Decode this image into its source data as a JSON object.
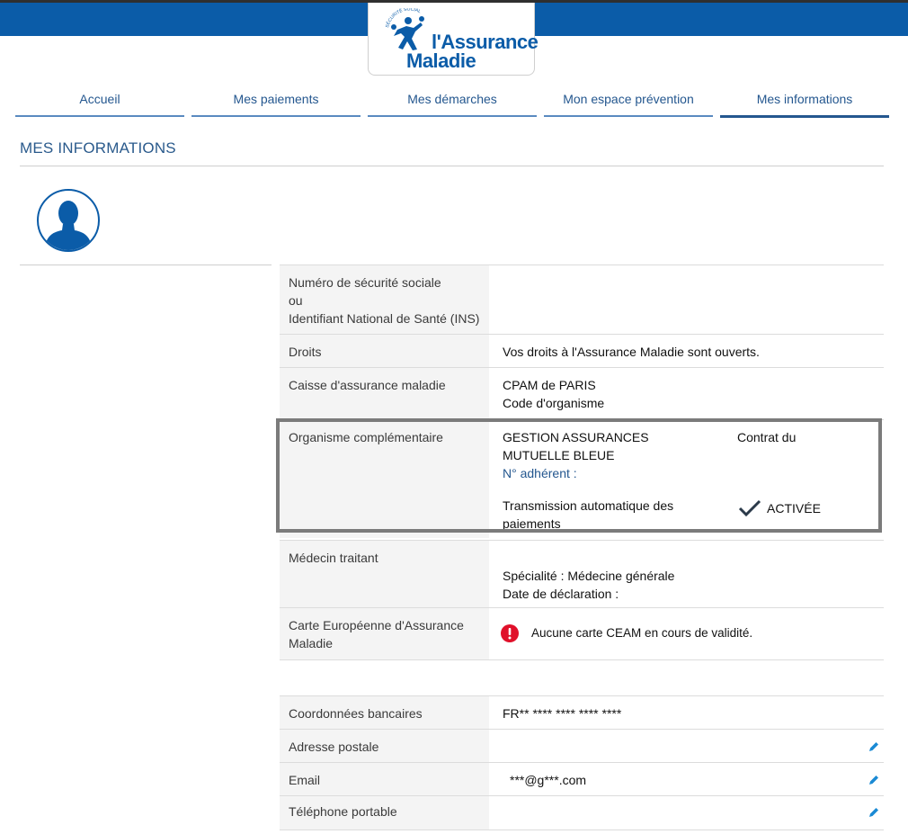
{
  "brand": {
    "logo_line1": "l'Assurance",
    "logo_line2": "Maladie",
    "logo_arc": "SÉCURITÉ SOCIALE",
    "color": "#0b5ca8"
  },
  "nav": {
    "items": [
      {
        "label": "Accueil"
      },
      {
        "label": "Mes paiements"
      },
      {
        "label": "Mes démarches"
      },
      {
        "label": "Mon espace prévention"
      },
      {
        "label": "Mes informations"
      }
    ],
    "active": "Mes informations"
  },
  "page": {
    "title": "MES INFORMATIONS"
  },
  "rows": {
    "nss": {
      "label": "Numéro de sécurité sociale\nou\nIdentifiant National de Santé (INS)"
    },
    "droits": {
      "label": "Droits",
      "value": "Vos droits à l'Assurance Maladie sont ouverts."
    },
    "caisse": {
      "label": "Caisse d'assurance maladie",
      "value1": "CPAM de PARIS",
      "value2": "Code d'organisme"
    },
    "complementaire": {
      "label": "Organisme complémentaire",
      "org1": "GESTION ASSURANCES",
      "org2": "MUTUELLE BLEUE",
      "adherent": "N° adhérent :",
      "contrat": "Contrat du",
      "transmission": "Transmission automatique des paiements",
      "status": "ACTIVÉE"
    },
    "medecin": {
      "label": "Médecin traitant",
      "specialite": "Spécialité : Médecine générale",
      "date": "Date de déclaration :"
    },
    "ceam": {
      "label": "Carte Européenne d'Assurance Maladie",
      "value": "Aucune carte CEAM en cours de validité."
    },
    "bancaires": {
      "label": "Coordonnées bancaires",
      "value": "FR** **** **** **** ****"
    },
    "adresse": {
      "label": "Adresse postale",
      "value": ""
    },
    "email": {
      "label": "Email",
      "value": "***@g***.com"
    },
    "telephone": {
      "label": "Téléphone portable",
      "value": ""
    }
  },
  "icons": {
    "edit": "pencil-icon",
    "check": "checkmark-icon",
    "alert": "exclamation-icon",
    "avatar": "user-silhouette-icon"
  },
  "colors": {
    "alert_red": "#e0102a",
    "edit_blue": "#1a8ad4"
  }
}
